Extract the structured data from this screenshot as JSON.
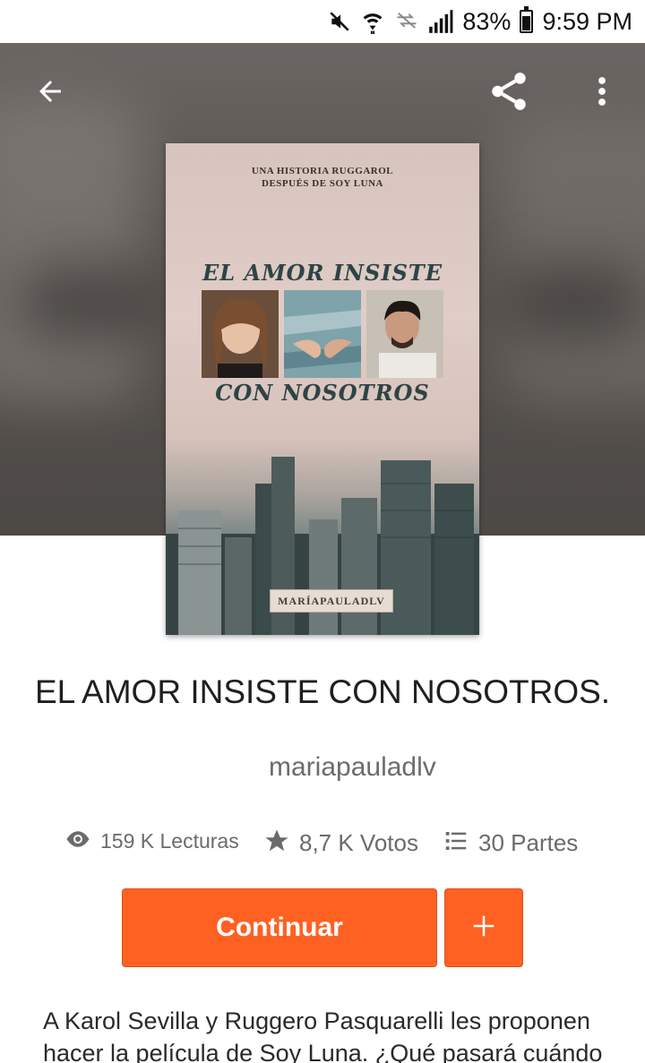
{
  "status_bar": {
    "battery_percent": "83%",
    "battery_level": 0.83,
    "time": "9:59 PM",
    "icons": [
      "mute-icon",
      "wifi-icon",
      "no-data-icon",
      "signal-icon",
      "battery-icon"
    ]
  },
  "toolbar": {
    "back_icon": "arrow-left-icon",
    "share_icon": "share-icon",
    "more_icon": "more-vertical-icon"
  },
  "cover": {
    "kicker": "UNA HISTORIA RUGGAROL\nDESPUÉS DE SOY LUNA",
    "title_line1": "EL AMOR INSISTE",
    "title_line2": "CON NOSOTROS",
    "author_tag": "MARÍAPAULADLV"
  },
  "story": {
    "title": "EL AMOR INSISTE CON NOSOTROS.",
    "author": "mariapauladlv"
  },
  "stats": {
    "reads": "159 K Lecturas",
    "votes": "8,7 K Votos",
    "parts": "30 Partes",
    "reads_icon": "eye-icon",
    "votes_icon": "star-icon",
    "parts_icon": "list-icon"
  },
  "actions": {
    "continue_label": "Continuar",
    "add_label": "+"
  },
  "description": "A Karol Sevilla y Ruggero Pasquarelli les proponen hacer la película de Soy Luna. ¿Qué pasará cuándo"
}
